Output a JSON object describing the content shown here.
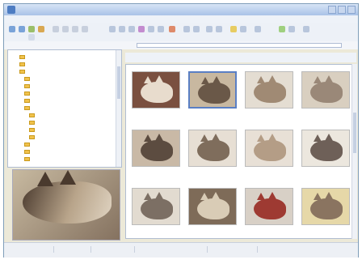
{
  "window": {
    "title": "",
    "colors": {
      "accent": "#5a7fc4",
      "folder": "#f1c24c"
    }
  },
  "menu": [],
  "address": {
    "value": ""
  },
  "tree": {
    "items": [
      "",
      "",
      "",
      "",
      "",
      "",
      "",
      "",
      "",
      "",
      "",
      "",
      "",
      "",
      ""
    ]
  },
  "thumbnails": [
    {
      "caption": "",
      "tone": "#7a5040",
      "fur": "#e8dccd"
    },
    {
      "caption": "",
      "tone": "#c8b8a0",
      "fur": "#6a5848",
      "selected": true
    },
    {
      "caption": "",
      "tone": "#e4ddd2",
      "fur": "#a08a74"
    },
    {
      "caption": "",
      "tone": "#d9cfc0",
      "fur": "#9a8878"
    },
    {
      "caption": "",
      "tone": "#c9b9a6",
      "fur": "#5c4c40"
    },
    {
      "caption": "",
      "tone": "#e7dfd4",
      "fur": "#7f6d5c"
    },
    {
      "caption": "",
      "tone": "#e8e0d6",
      "fur": "#b49d86"
    },
    {
      "caption": "",
      "tone": "#ece7de",
      "fur": "#6e6058"
    },
    {
      "caption": "",
      "tone": "#e2dbd0",
      "fur": "#7c6f64"
    },
    {
      "caption": "",
      "tone": "#7e6b58",
      "fur": "#d9ccb6"
    },
    {
      "caption": "",
      "tone": "#d8d0c6",
      "fur": "#9e3a32"
    },
    {
      "caption": "",
      "tone": "#e6d8a8",
      "fur": "#8a7460"
    }
  ],
  "status": {
    "segments": [
      "",
      "",
      "",
      "",
      ""
    ]
  }
}
